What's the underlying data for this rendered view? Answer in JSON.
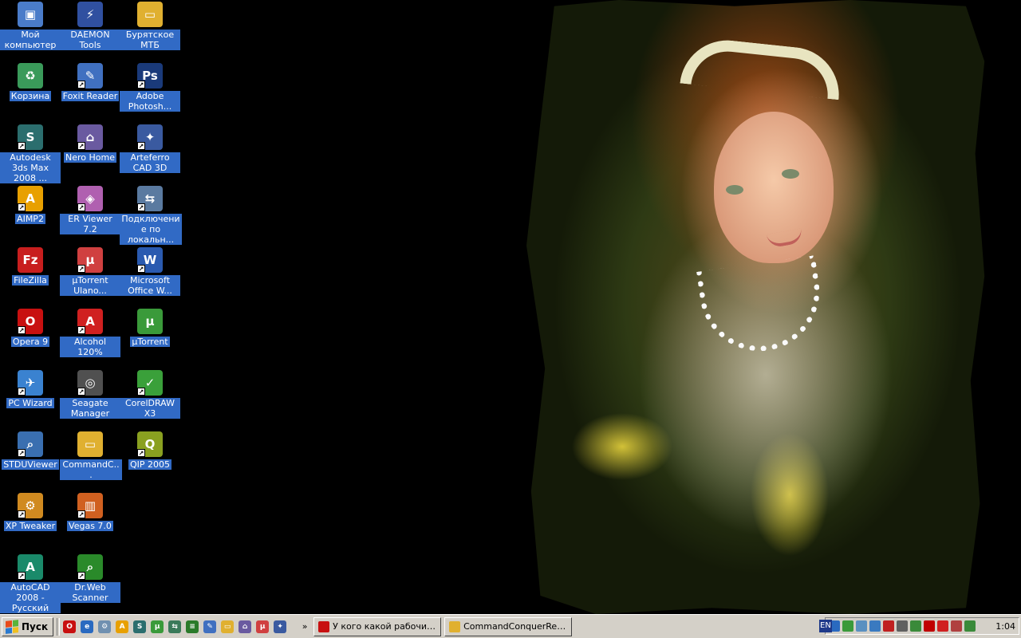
{
  "desktop": {
    "icons": [
      {
        "label": "Мой компьютер",
        "glyph": "▣",
        "color": "#4a7cc9",
        "shortcut": false
      },
      {
        "label": "Корзина",
        "glyph": "♻",
        "color": "#3a9a5a",
        "shortcut": false
      },
      {
        "label": "Autodesk 3ds Max 2008 ...",
        "glyph": "S",
        "color": "#2b6e6e",
        "shortcut": true
      },
      {
        "label": "AIMP2",
        "glyph": "A",
        "color": "#e8a000",
        "shortcut": true
      },
      {
        "label": "FileZilla",
        "glyph": "Fz",
        "color": "#c81e1e",
        "shortcut": false
      },
      {
        "label": "Opera 9",
        "glyph": "O",
        "color": "#c81010",
        "shortcut": true
      },
      {
        "label": "PC Wizard",
        "glyph": "✈",
        "color": "#3a82d0",
        "shortcut": true
      },
      {
        "label": "STDUViewer",
        "glyph": "⌕",
        "color": "#3a6fb0",
        "shortcut": true
      },
      {
        "label": "XP Tweaker",
        "glyph": "⚙",
        "color": "#d08a20",
        "shortcut": true
      },
      {
        "label": "AutoCAD 2008 - Русский",
        "glyph": "A",
        "color": "#1a8a6a",
        "shortcut": true
      },
      {
        "label": "DAEMON Tools",
        "glyph": "⚡",
        "color": "#3050a0",
        "shortcut": false
      },
      {
        "label": "Foxit Reader",
        "glyph": "✎",
        "color": "#4070c0",
        "shortcut": true
      },
      {
        "label": "Nero Home",
        "glyph": "⌂",
        "color": "#6a5aa0",
        "shortcut": true
      },
      {
        "label": "ER Viewer 7.2",
        "glyph": "◈",
        "color": "#b060b0",
        "shortcut": true
      },
      {
        "label": "µTorrent Ulano...",
        "glyph": "µ",
        "color": "#d04040",
        "shortcut": true
      },
      {
        "label": "Alcohol 120%",
        "glyph": "A",
        "color": "#d02020",
        "shortcut": true
      },
      {
        "label": "Seagate Manager",
        "glyph": "◎",
        "color": "#505050",
        "shortcut": true
      },
      {
        "label": "CommandC...",
        "glyph": "▭",
        "color": "#e0b030",
        "shortcut": false
      },
      {
        "label": "Vegas 7.0",
        "glyph": "▥",
        "color": "#d06020",
        "shortcut": true
      },
      {
        "label": "Dr.Web Scanner",
        "glyph": "⌕",
        "color": "#2a8a2a",
        "shortcut": true
      },
      {
        "label": "Бурятское МТБ",
        "glyph": "▭",
        "color": "#e0b030",
        "shortcut": false
      },
      {
        "label": "Adobe Photosh...",
        "glyph": "Ps",
        "color": "#1a3a7a",
        "shortcut": true
      },
      {
        "label": "Arteferro CAD 3D",
        "glyph": "✦",
        "color": "#3a5aa0",
        "shortcut": true
      },
      {
        "label": "Подключение по локальн...",
        "glyph": "⇆",
        "color": "#5a7aa0",
        "shortcut": true
      },
      {
        "label": "Microsoft Office W...",
        "glyph": "W",
        "color": "#2a5ab0",
        "shortcut": true
      },
      {
        "label": "µTorrent",
        "glyph": "µ",
        "color": "#3a9a3a",
        "shortcut": false
      },
      {
        "label": "CorelDRAW X3",
        "glyph": "✓",
        "color": "#3aa03a",
        "shortcut": true
      },
      {
        "label": "QIP 2005",
        "glyph": "Q",
        "color": "#8aa020",
        "shortcut": true
      }
    ]
  },
  "taskbar": {
    "start_label": "Пуск",
    "quick_launch": [
      {
        "name": "opera-icon",
        "color": "#c81010",
        "glyph": "O"
      },
      {
        "name": "ie-icon",
        "color": "#2a6ac0",
        "glyph": "e"
      },
      {
        "name": "gear-icon",
        "color": "#7090b0",
        "glyph": "⚙"
      },
      {
        "name": "aimp-icon",
        "color": "#e8a000",
        "glyph": "A"
      },
      {
        "name": "3dsmax-icon",
        "color": "#2b6e6e",
        "glyph": "S"
      },
      {
        "name": "utorrent-icon",
        "color": "#3a9a3a",
        "glyph": "µ"
      },
      {
        "name": "network-icon",
        "color": "#3a7a5a",
        "glyph": "⇆"
      },
      {
        "name": "scanner-icon",
        "color": "#2a7a2a",
        "glyph": "≡"
      },
      {
        "name": "foxit-icon",
        "color": "#4070c0",
        "glyph": "✎"
      },
      {
        "name": "folder-icon",
        "color": "#e0b030",
        "glyph": "▭"
      },
      {
        "name": "nero-icon",
        "color": "#6a5aa0",
        "glyph": "⌂"
      },
      {
        "name": "utorrent-red-icon",
        "color": "#d04040",
        "glyph": "µ"
      },
      {
        "name": "arteferro-icon",
        "color": "#3a5aa0",
        "glyph": "✦"
      }
    ],
    "overflow": "»",
    "tasks": [
      {
        "label": "У кого какой рабочий с...",
        "color": "#c81010"
      },
      {
        "label": "CommandConquerRedAl...",
        "color": "#e0b030"
      }
    ],
    "tray": {
      "lang": "EN",
      "icons": [
        "#2a6ac0",
        "#3a9a3a",
        "#5a90c0",
        "#3a7ac0",
        "#c02020",
        "#606060",
        "#3a8a3a",
        "#c00000",
        "#d02020",
        "#b04040",
        "#3a8a3a"
      ],
      "clock": "1:04"
    }
  }
}
